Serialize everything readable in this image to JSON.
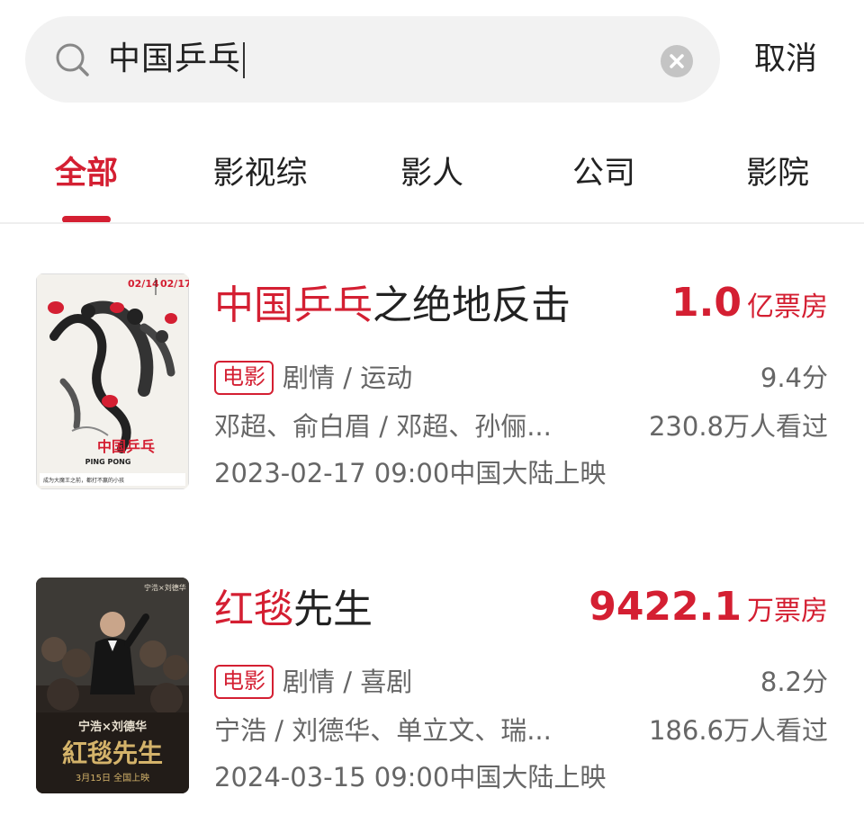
{
  "search": {
    "query": "中国乒乓",
    "cancel_label": "取消"
  },
  "tabs": [
    {
      "label": "全部",
      "active": true
    },
    {
      "label": "影视综",
      "active": false
    },
    {
      "label": "影人",
      "active": false
    },
    {
      "label": "公司",
      "active": false
    },
    {
      "label": "影院",
      "active": false
    }
  ],
  "results": [
    {
      "title_highlight": "中国乒乓",
      "title_rest": "之绝地反击",
      "box_office_value": "1.0",
      "box_office_unit": "亿票房",
      "tag": "电影",
      "genre": "剧情 / 运动",
      "rating": "9.4分",
      "people": "邓超、俞白眉 / 邓超、孙俪...",
      "viewers": "230.8万人看过",
      "release": "2023-02-17 09:00中国大陆上映",
      "poster": {
        "date_left": "02/14",
        "date_right": "02/17",
        "title": "中国乒乓",
        "subtitle": "PING PONG",
        "tagline": "成为大魔王之前，都打不赢的小孩",
        "accent": "#d41f32"
      }
    },
    {
      "title_highlight": "红毯",
      "title_rest": "先生",
      "box_office_value": "9422.1",
      "box_office_unit": "万票房",
      "tag": "电影",
      "genre": "剧情 / 喜剧",
      "rating": "8.2分",
      "people": "宁浩 / 刘德华、单立文、瑞...",
      "viewers": "186.6万人看过",
      "release": "2024-03-15 09:00中国大陆上映",
      "poster": {
        "cast": "宁浩×刘德华",
        "title": "紅毯先生",
        "bottom": "3月15日 全国上映",
        "accent": "#d4b36a"
      }
    }
  ],
  "colors": {
    "accent": "#d41f32",
    "secondary_text": "#666666",
    "search_bg": "#f2f2f2"
  }
}
